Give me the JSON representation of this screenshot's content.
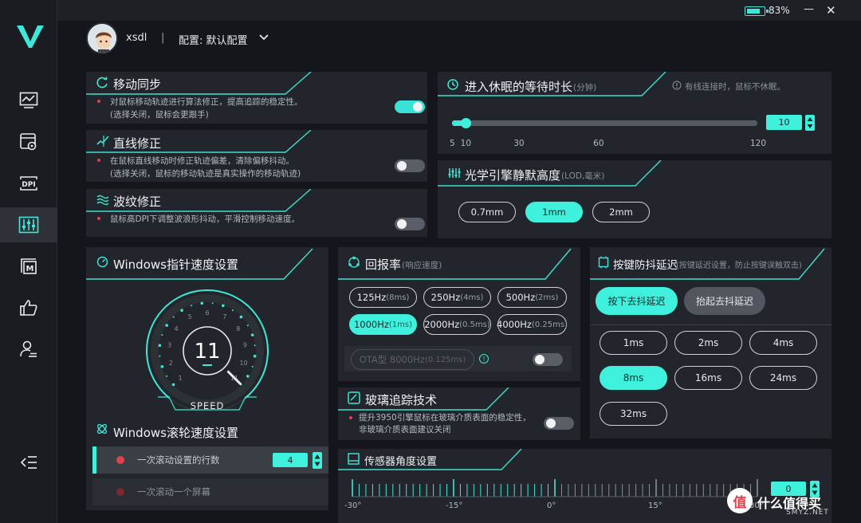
{
  "battery": {
    "percent": "83%",
    "level": 0.83
  },
  "window_controls": {
    "minimize": "—",
    "close": "✕"
  },
  "user": {
    "name": "xsdl",
    "separator": "|",
    "config_label": "配置: 默认配置"
  },
  "sidebar": {
    "items": [
      {
        "icon": "monitor-icon"
      },
      {
        "icon": "image-settings-icon"
      },
      {
        "icon": "dpi-icon",
        "label": "DPI"
      },
      {
        "icon": "sliders-icon",
        "active": true
      },
      {
        "icon": "macro-icon",
        "label": "M"
      },
      {
        "icon": "thumbs-up-icon"
      },
      {
        "icon": "user-settings-icon"
      },
      {
        "icon": "collapse-menu-icon"
      }
    ]
  },
  "motion_sync": {
    "title": "移动同步",
    "desc1": "对鼠标移动轨迹进行算法修正，提高追踪的稳定性。",
    "desc2": "(选择关闭，鼠标会更跟手)",
    "enabled": true
  },
  "angle_snap": {
    "title": "直线修正",
    "desc1": "在鼠标直线移动时修正轨迹偏差，清除偏移抖动。",
    "desc2": "(选择关闭，鼠标的移动轨迹是真实操作的移动轨迹)",
    "enabled": false
  },
  "ripple": {
    "title": "波纹修正",
    "desc1": "鼠标高DPI下调整波浪形抖动，平滑控制移动速度。",
    "enabled": false
  },
  "sleep": {
    "title": "进入休眠的等待时长",
    "unit": "(分钟)",
    "note": "有线连接时，鼠标不休眠。",
    "value": "10",
    "min": 5,
    "max": 120,
    "ticks": [
      "5",
      "10",
      "30",
      "60",
      "120"
    ]
  },
  "lod": {
    "title": "光学引擎静默高度",
    "unit": "(LOD,毫米)",
    "options": [
      "0.7mm",
      "1mm",
      "2mm"
    ],
    "selected": "1mm"
  },
  "pointer_speed": {
    "title": "Windows指针速度设置",
    "value": "11",
    "label": "SPEED",
    "dial_numbers": [
      "1",
      "2",
      "3",
      "4",
      "5",
      "6",
      "7",
      "8",
      "9",
      "10",
      "11"
    ]
  },
  "scroll_speed": {
    "title": "Windows滚轮速度设置",
    "option1": "一次滚动设置的行数",
    "option1_value": "4",
    "option2": "一次滚动一个屏幕"
  },
  "polling": {
    "title": "回报率",
    "sub": "(响应速度)",
    "options": [
      {
        "main": "125Hz",
        "sub": "(8ms)"
      },
      {
        "main": "250Hz",
        "sub": "(4ms)"
      },
      {
        "main": "500Hz",
        "sub": "(2ms)"
      },
      {
        "main": "1000Hz",
        "sub": "(1ms)",
        "selected": true
      },
      {
        "main": "2000Hz",
        "sub": "(0.5ms)"
      },
      {
        "main": "4000Hz",
        "sub": "(0.25ms)"
      }
    ],
    "ota": {
      "main": "OTA型 8000Hz",
      "sub": "(0.125ms)",
      "info": "!"
    }
  },
  "glass": {
    "title": "玻璃追踪技术",
    "desc1": "提升3950引擎鼠标在玻璃介质表面的稳定性，",
    "desc2": "非玻璃介质表面建议关闭",
    "enabled": false
  },
  "debounce": {
    "title": "按键防抖延迟",
    "sub": "(按键延迟设置，防止按键误触双击)",
    "tabs": [
      "按下去抖延迟",
      "抬起去抖延迟"
    ],
    "options": [
      "1ms",
      "2ms",
      "4ms",
      "8ms",
      "16ms",
      "24ms",
      "32ms"
    ],
    "selected": "8ms"
  },
  "sensor_angle": {
    "title": "传感器角度设置",
    "value": "0",
    "ticks": [
      "-30°",
      "-15°",
      "0°",
      "15°",
      "30°"
    ]
  },
  "watermark": {
    "glyph": "值",
    "text": "什么值得买",
    "sub": "SMYZ.NET"
  },
  "colors": {
    "accent": "#3ff0dd",
    "panel": "#22252b",
    "background": "#14161b",
    "red": "#e0414b"
  }
}
